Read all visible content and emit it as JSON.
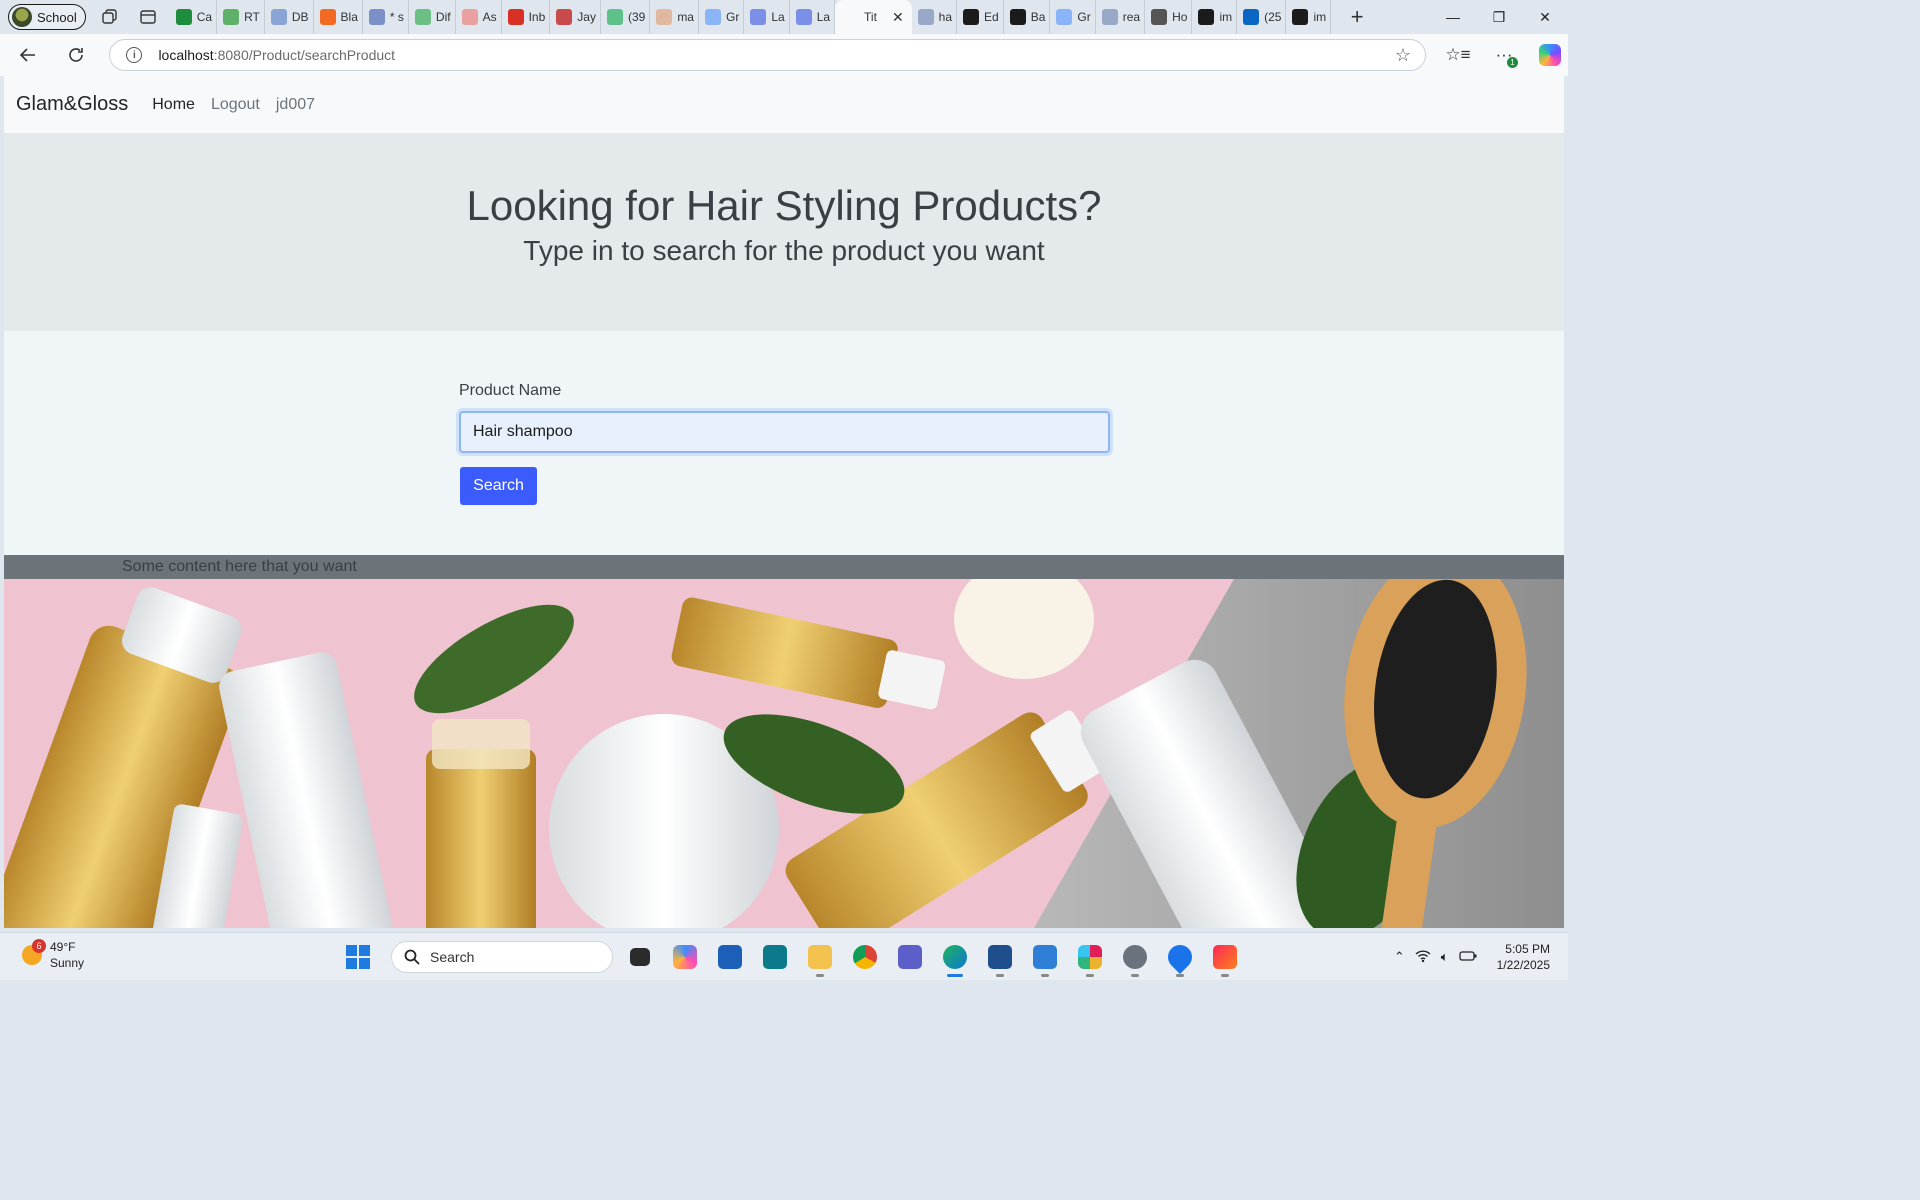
{
  "browser": {
    "profile_label": "School",
    "tabs": [
      {
        "label": "Ca",
        "icon": "sheets-icon",
        "color": "#1e8e3e"
      },
      {
        "label": "RT",
        "icon": "sheets-icon",
        "color": "#5fb069"
      },
      {
        "label": "DB",
        "icon": "database-icon",
        "color": "#8aa4d6"
      },
      {
        "label": "Bla",
        "icon": "blackboard-icon",
        "color": "#f26a21"
      },
      {
        "label": "* s",
        "icon": "doc-icon",
        "color": "#7b8fc9"
      },
      {
        "label": "Dif",
        "icon": "diff-icon",
        "color": "#6cbf84"
      },
      {
        "label": "As",
        "icon": "gmail-icon",
        "color": "#e8a0a0"
      },
      {
        "label": "Inb",
        "icon": "gmail-icon",
        "color": "#d93025"
      },
      {
        "label": "Jay",
        "icon": "pdf-icon",
        "color": "#c94a4a"
      },
      {
        "label": "(39",
        "icon": "chat-icon",
        "color": "#5ec18a"
      },
      {
        "label": "ma",
        "icon": "pen-icon",
        "color": "#e0b8a0"
      },
      {
        "label": "Gr",
        "icon": "shield-icon",
        "color": "#8ab4f8"
      },
      {
        "label": "La",
        "icon": "zoom-icon",
        "color": "#7a8fe8"
      },
      {
        "label": "La",
        "icon": "zoom-icon",
        "color": "#7a8fe8"
      },
      {
        "label": "Tit",
        "icon": "page-icon",
        "color": "#f7f9fb",
        "active": true
      },
      {
        "label": "ha",
        "icon": "search-icon",
        "color": "#9aa8c8"
      },
      {
        "label": "Ed",
        "icon": "github-icon",
        "color": "#1b1b1b"
      },
      {
        "label": "Ba",
        "icon": "github-icon",
        "color": "#1b1b1b"
      },
      {
        "label": "Gr",
        "icon": "shield-icon",
        "color": "#8ab4f8"
      },
      {
        "label": "rea",
        "icon": "search-icon",
        "color": "#9aa8c8"
      },
      {
        "label": "Ho",
        "icon": "app-icon",
        "color": "#555555"
      },
      {
        "label": "im",
        "icon": "github-icon",
        "color": "#1b1b1b"
      },
      {
        "label": "(25",
        "icon": "linkedin-icon",
        "color": "#0a66c2"
      },
      {
        "label": "im",
        "icon": "github-icon",
        "color": "#1b1b1b"
      }
    ],
    "url_host": "localhost",
    "url_path": ":8080/Product/searchProduct"
  },
  "site": {
    "brand": "Glam&Gloss",
    "nav": {
      "home": "Home",
      "logout": "Logout",
      "user": "jd007"
    },
    "hero_title": "Looking for Hair Styling Products?",
    "hero_subtitle": "Type in to search for the product you want",
    "form": {
      "label": "Product Name",
      "value": "Hair shampoo",
      "button": "Search"
    },
    "footer_text": "Some content here that you want"
  },
  "taskbar": {
    "weather_temp": "49°F",
    "weather_desc": "Sunny",
    "weather_badge": "6",
    "search_label": "Search",
    "time": "5:05 PM",
    "date": "1/22/2025"
  }
}
